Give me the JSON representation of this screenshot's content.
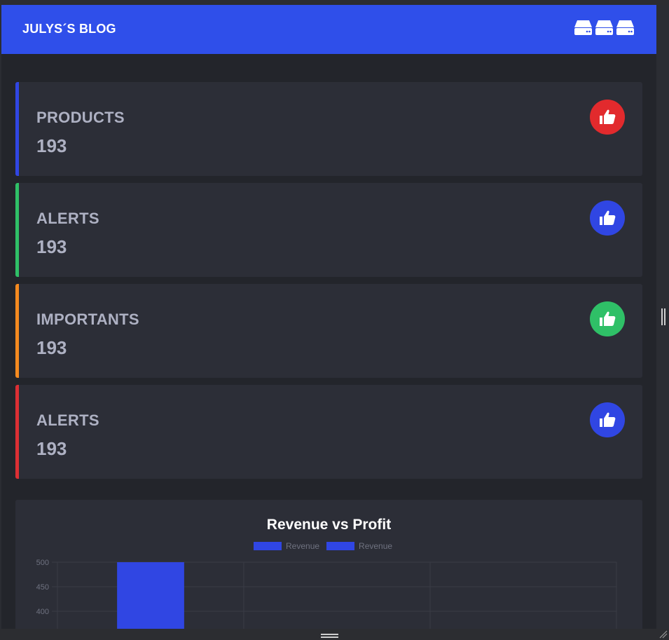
{
  "header": {
    "brand": "JULYS´S BLOG",
    "icons": [
      "drive-icon",
      "drive-icon",
      "drive-icon"
    ]
  },
  "cards": [
    {
      "label": "PRODUCTS",
      "value": "193",
      "accent": "#3046e3",
      "badge_color": "#e22a2d",
      "icon": "thumbs-up-icon"
    },
    {
      "label": "ALERTS",
      "value": "193",
      "accent": "#2fc067",
      "badge_color": "#3046e3",
      "icon": "thumbs-up-icon"
    },
    {
      "label": "IMPORTANTS",
      "value": "193",
      "accent": "#f58a1f",
      "badge_color": "#2fc067",
      "icon": "thumbs-up-icon"
    },
    {
      "label": "ALERTS",
      "value": "193",
      "accent": "#dc2f34",
      "badge_color": "#3046e3",
      "icon": "thumbs-up-icon"
    }
  ],
  "chart": {
    "title": "Revenue vs Profit",
    "legend": [
      {
        "label": "Revenue",
        "color": "#3046e3"
      },
      {
        "label": "Revenue",
        "color": "#3046e3"
      }
    ]
  },
  "chart_data": {
    "type": "bar",
    "title": "Revenue vs Profit",
    "series": [
      {
        "name": "Revenue",
        "values": [
          500,
          null,
          null
        ]
      }
    ],
    "y_ticks_visible": [
      500,
      450,
      400
    ],
    "ylim_visible": [
      360,
      500
    ],
    "grid": true,
    "legend_position": "top",
    "color": "#3046e3"
  }
}
